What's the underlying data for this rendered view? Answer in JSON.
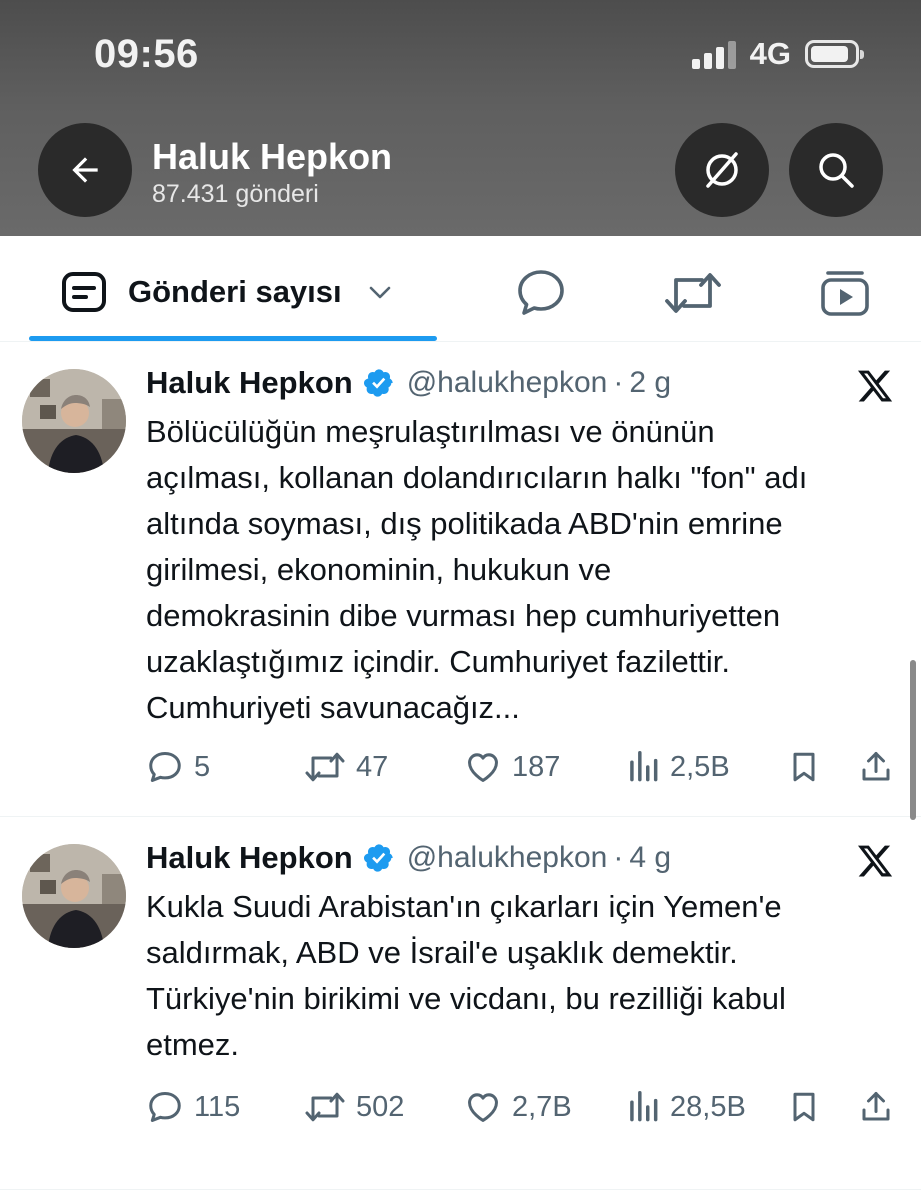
{
  "status_bar": {
    "time": "09:56",
    "network": "4G"
  },
  "header": {
    "name": "Haluk Hepkon",
    "post_count": "87.431 gönderi",
    "icons": {
      "back": "back-arrow-icon",
      "grok": "grok-icon",
      "search": "search-icon"
    }
  },
  "tabs": {
    "active_label": "Gönderi sayısı",
    "icons": [
      "posts-icon",
      "chevron-down-icon",
      "replies-icon",
      "reposts-icon",
      "media-icon"
    ],
    "accent_color": "#1d9bf0"
  },
  "tweets": [
    {
      "name": "Haluk Hepkon",
      "handle": "@halukhepkon",
      "dot": "·",
      "time": "2 g",
      "text": "Bölücülüğün meşrulaştırılması ve önünün\naçılması, kollanan dolandırıcıların halkı \"fon\" adı\naltında soyması, dış politikada ABD'nin emrine\ngirilmesi, ekonominin, hukukun ve\ndemokrasinin dibe vurması hep cumhuriyetten\nuzaklaştığımız içindir. Cumhuriyet fazilettir.\nCumhuriyeti savunacağız...",
      "replies": "5",
      "reposts": "47",
      "likes": "187",
      "views": "2,5B"
    },
    {
      "name": "Haluk Hepkon",
      "handle": "@halukhepkon",
      "dot": "·",
      "time": "4 g",
      "text": "Kukla Suudi Arabistan'ın çıkarları için Yemen'e\nsaldırmak, ABD ve İsrail'e uşaklık demektir.\nTürkiye'nin birikimi ve vicdanı, bu rezilliği kabul\netmez.",
      "replies": "115",
      "reposts": "502",
      "likes": "2,7B",
      "views": "28,5B"
    }
  ],
  "colors": {
    "verified": "#1d9bf0",
    "secondary_text": "#536471"
  }
}
